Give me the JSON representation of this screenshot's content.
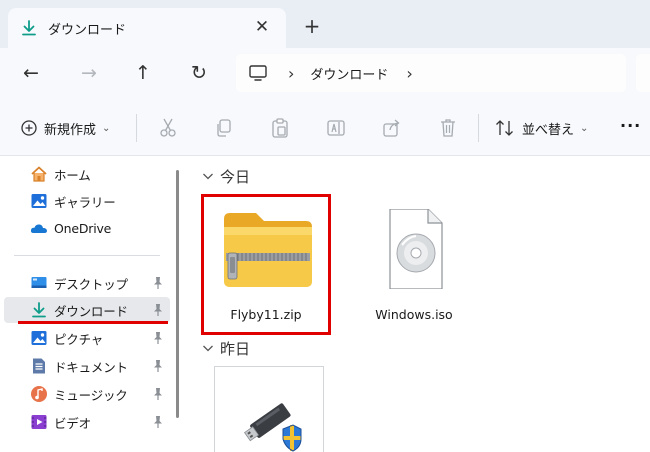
{
  "tab": {
    "title": "ダウンロード",
    "close": "✕",
    "new_tab": "+"
  },
  "nav": {
    "back": "←",
    "forward": "→",
    "up": "↑",
    "refresh": "↻"
  },
  "address": {
    "separator": "›",
    "crumb": "ダウンロード"
  },
  "commands": {
    "new_label": "新規作成",
    "sort_label": "並べ替え",
    "chevron": "⌄",
    "more": "···"
  },
  "sidebar": {
    "items": [
      {
        "label": "ホーム",
        "icon": "home-icon"
      },
      {
        "label": "ギャラリー",
        "icon": "gallery-icon"
      },
      {
        "label": "OneDrive",
        "icon": "onedrive-icon"
      },
      {
        "label": "デスクトップ",
        "icon": "desktop-icon",
        "pinned": true
      },
      {
        "label": "ダウンロード",
        "icon": "download-icon",
        "pinned": true,
        "selected": true
      },
      {
        "label": "ピクチャ",
        "icon": "pictures-icon",
        "pinned": true
      },
      {
        "label": "ドキュメント",
        "icon": "documents-icon",
        "pinned": true
      },
      {
        "label": "ミュージック",
        "icon": "music-icon",
        "pinned": true
      },
      {
        "label": "ビデオ",
        "icon": "video-icon",
        "pinned": true
      }
    ]
  },
  "groups": [
    {
      "label": "今日"
    },
    {
      "label": "昨日"
    }
  ],
  "files": {
    "zip": {
      "name": "Flyby11.zip",
      "icon": "zip-folder-icon"
    },
    "iso": {
      "name": "Windows.iso",
      "icon": "disc-image-icon"
    },
    "usb": {
      "icon": "usb-drive-shield-icon"
    }
  },
  "colors": {
    "highlight": "#e00000",
    "accent": "#0f9d8a",
    "folder": "#f7c948"
  }
}
